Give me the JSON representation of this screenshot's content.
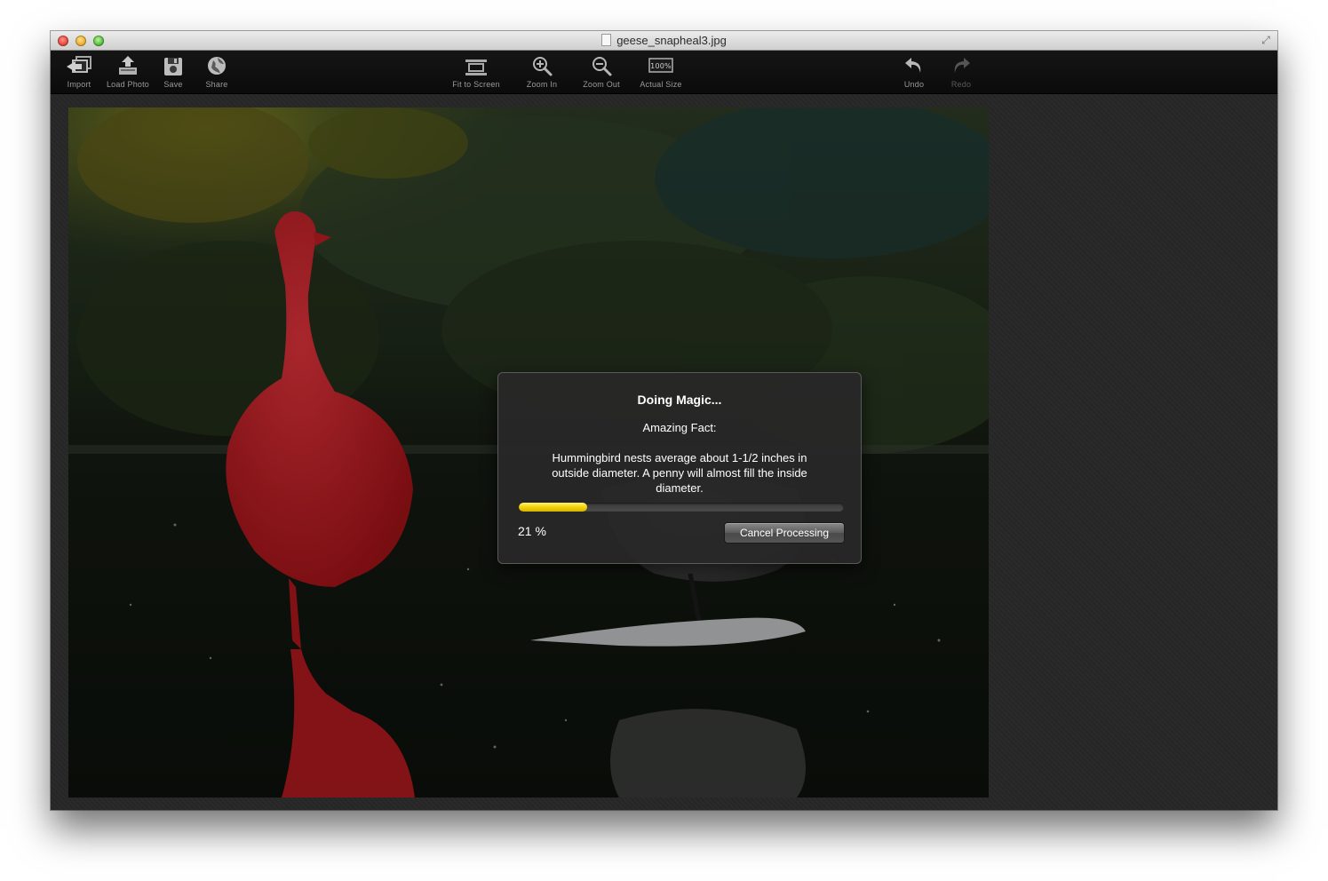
{
  "window": {
    "title": "geese_snapheal3.jpg",
    "controls": [
      "close",
      "minimize",
      "zoom"
    ]
  },
  "toolbar": {
    "left": [
      {
        "label": "Import",
        "icon": "import-icon"
      },
      {
        "label": "Load Photo",
        "icon": "load-photo-icon"
      },
      {
        "label": "Save",
        "icon": "save-icon"
      },
      {
        "label": "Share",
        "icon": "share-icon"
      }
    ],
    "center": [
      {
        "label": "Fit to Screen",
        "icon": "fit-to-screen-icon"
      },
      {
        "label": "Zoom In",
        "icon": "zoom-in-icon"
      },
      {
        "label": "Zoom Out",
        "icon": "zoom-out-icon"
      },
      {
        "label": "Actual Size",
        "icon": "actual-size-icon",
        "badge": "100%"
      }
    ],
    "right": [
      {
        "label": "Undo",
        "icon": "undo-icon",
        "enabled": true
      },
      {
        "label": "Redo",
        "icon": "redo-icon",
        "enabled": false
      }
    ]
  },
  "image": {
    "description_colors": {
      "mask": "#c4181c",
      "water": "#0e120c",
      "foliage": "#22301d"
    }
  },
  "dialog": {
    "title": "Doing Magic...",
    "subtitle": "Amazing Fact:",
    "fact": "Hummingbird nests average about 1-1/2 inches in outside diameter. A penny will almost fill the inside diameter.",
    "progress_percent": 21,
    "progress_text": "21 %",
    "cancel_label": "Cancel Processing",
    "progress_color": "#f2d40b"
  }
}
